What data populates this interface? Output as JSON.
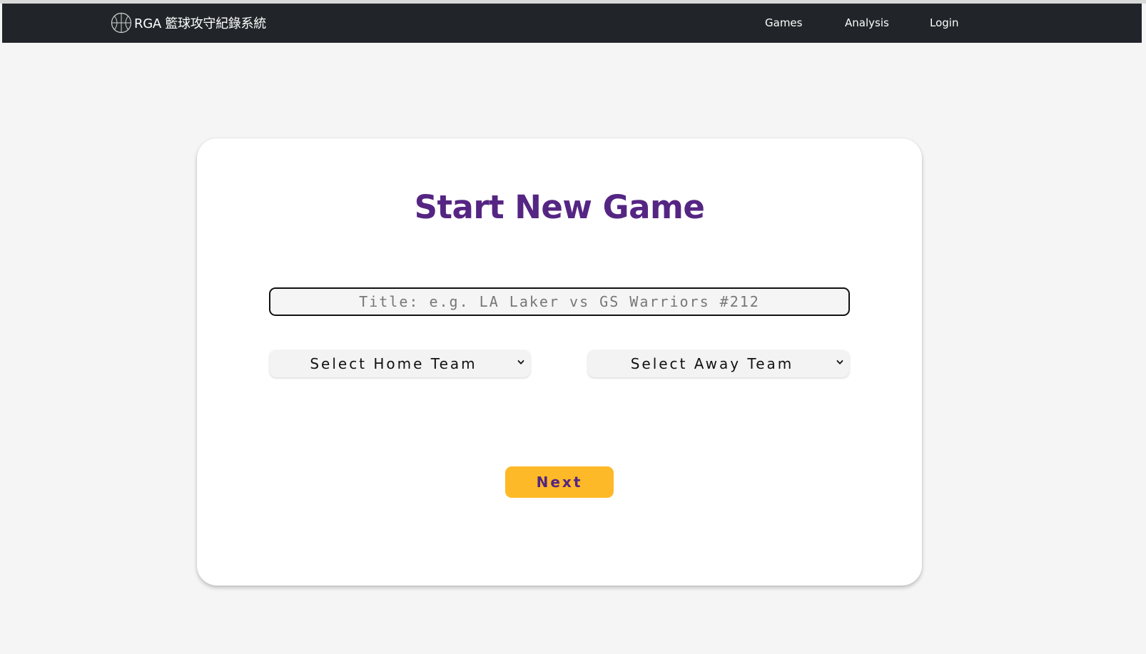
{
  "navbar": {
    "brand": "RGA 籃球攻守紀錄系統",
    "brand_icon": "basketball-icon",
    "links": [
      "Games",
      "Analysis",
      "Login"
    ],
    "background": "#212529"
  },
  "form": {
    "title": "Start New Game",
    "title_input": {
      "placeholder": "Title: e.g. LA Laker vs GS Warriors #212",
      "value": ""
    },
    "home_team": {
      "selected": "Select Home Team"
    },
    "away_team": {
      "selected": "Select Away Team"
    },
    "next_label": "Next"
  },
  "colors": {
    "accent_purple": "#552583",
    "accent_gold": "#fdb927",
    "page_background": "#f5f5f5"
  }
}
